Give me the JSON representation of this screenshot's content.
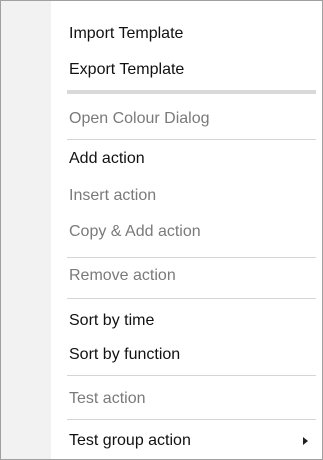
{
  "menu": {
    "items": [
      {
        "label": "Import Template",
        "enabled": true
      },
      {
        "label": "Export Template",
        "enabled": true
      },
      {
        "label": "Open Colour Dialog",
        "enabled": false
      },
      {
        "label": "Add action",
        "enabled": true
      },
      {
        "label": "Insert action",
        "enabled": false
      },
      {
        "label": "Copy & Add action",
        "enabled": false
      },
      {
        "label": "Remove action",
        "enabled": false
      },
      {
        "label": "Sort by time",
        "enabled": true
      },
      {
        "label": "Sort by function",
        "enabled": true
      },
      {
        "label": "Test action",
        "enabled": false
      },
      {
        "label": "Test group action",
        "enabled": true,
        "submenu": true
      }
    ]
  },
  "colors": {
    "enabled_text": "#111111",
    "disabled_text": "#7a7a7a",
    "gutter": "#f2f2f2",
    "separator": "#d5d5d5",
    "border": "#a0a0a0"
  }
}
